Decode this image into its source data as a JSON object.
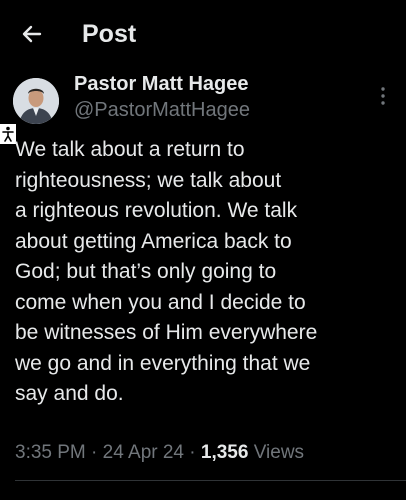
{
  "header": {
    "title": "Post"
  },
  "author": {
    "name": "Pastor Matt Hagee",
    "handle": "@PastorMattHagee"
  },
  "post": {
    "lines": [
      "We talk about a return to",
      "righteousness; we talk about",
      "a righteous revolution. We talk",
      "about getting America back to",
      "God; but that’s only going to",
      "come when you and I decide to",
      "be witnesses of Him everywhere",
      "we go and in everything that we",
      "say and do."
    ]
  },
  "meta": {
    "time": "3:35 PM",
    "separator": "·",
    "date": "24 Apr 24",
    "views_count": "1,356",
    "views_label": "Views"
  },
  "colors": {
    "background": "#000000",
    "text_primary": "#e7e9ea",
    "text_secondary": "#71767b",
    "divider": "#2f3336"
  },
  "icons": {
    "back": "arrow-left-icon",
    "more": "more-vertical-icon",
    "accessibility": "accessibility-icon"
  }
}
